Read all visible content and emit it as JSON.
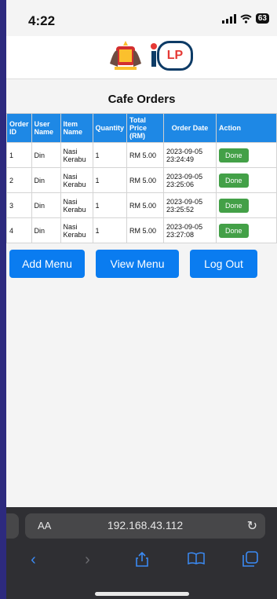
{
  "status": {
    "time": "4:22",
    "battery": "63"
  },
  "page": {
    "title": "Cafe Orders"
  },
  "table": {
    "headers": [
      "Order ID",
      "User Name",
      "Item Name",
      "Quantity",
      "Total Price (RM)",
      "Order Date",
      "Action"
    ],
    "rows": [
      {
        "id": "1",
        "user": "Din",
        "item": "Nasi Kerabu",
        "qty": "1",
        "price": "RM 5.00",
        "date": "2023-09-05 23:24:49",
        "action": "Done"
      },
      {
        "id": "2",
        "user": "Din",
        "item": "Nasi Kerabu",
        "qty": "1",
        "price": "RM 5.00",
        "date": "2023-09-05 23:25:06",
        "action": "Done"
      },
      {
        "id": "3",
        "user": "Din",
        "item": "Nasi Kerabu",
        "qty": "1",
        "price": "RM 5.00",
        "date": "2023-09-05 23:25:52",
        "action": "Done"
      },
      {
        "id": "4",
        "user": "Din",
        "item": "Nasi Kerabu",
        "qty": "1",
        "price": "RM 5.00",
        "date": "2023-09-05 23:27:08",
        "action": "Done"
      }
    ]
  },
  "buttons": {
    "add_menu": "Add Menu",
    "view_menu": "View Menu",
    "log_out": "Log Out"
  },
  "browser": {
    "aa": "AA",
    "address": "192.168.43.112"
  },
  "logo": {
    "right_text": "LP"
  }
}
